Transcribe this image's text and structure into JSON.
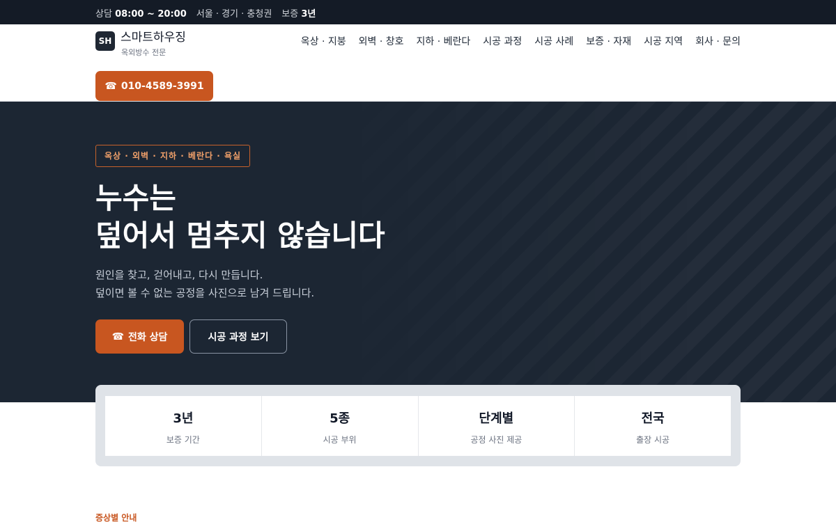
{
  "topbar": {
    "hours_label": "상담",
    "hours_value": "08:00 ~ 20:00",
    "region": "서울 · 경기 · 충청권",
    "warranty_label": "보증",
    "warranty_value": "3년"
  },
  "header": {
    "logo_initials": "SH",
    "brand_name": "스마트하우징",
    "brand_sub": "옥외방수 전문",
    "nav": [
      {
        "label": "옥상 · 지붕"
      },
      {
        "label": "외벽 · 창호"
      },
      {
        "label": "지하 · 베란다"
      },
      {
        "label": "시공 과정"
      },
      {
        "label": "시공 사례"
      },
      {
        "label": "보증 · 자재"
      },
      {
        "label": "시공 지역"
      },
      {
        "label": "회사 · 문의"
      }
    ],
    "call_icon": "☎",
    "call_icon_name": "phone-icon",
    "phone": "010-4589-3991"
  },
  "hero": {
    "tag": "옥상 · 외벽 · 지하 · 베란다 · 욕실",
    "title_line1": "누수는",
    "title_line2": "덮어서 멈추지 않습니다",
    "desc_line1": "원인을 찾고, 걷어내고, 다시 만듭니다.",
    "desc_line2": "덮이면 볼 수 없는 공정을 사진으로 남겨 드립니다.",
    "primary_icon": "☎",
    "primary_label": "전화 상담",
    "secondary_label": "시공 과정 보기"
  },
  "stats": [
    {
      "value": "3년",
      "label": "보증 기간"
    },
    {
      "value": "5종",
      "label": "시공 부위"
    },
    {
      "value": "단계별",
      "label": "공정 사진 제공"
    },
    {
      "value": "전국",
      "label": "출장 시공"
    }
  ],
  "section": {
    "label": "증상별 안내"
  },
  "colors": {
    "accent": "#c85620",
    "topbar_bg": "#141b26",
    "hero_bg": "#1c2633"
  }
}
